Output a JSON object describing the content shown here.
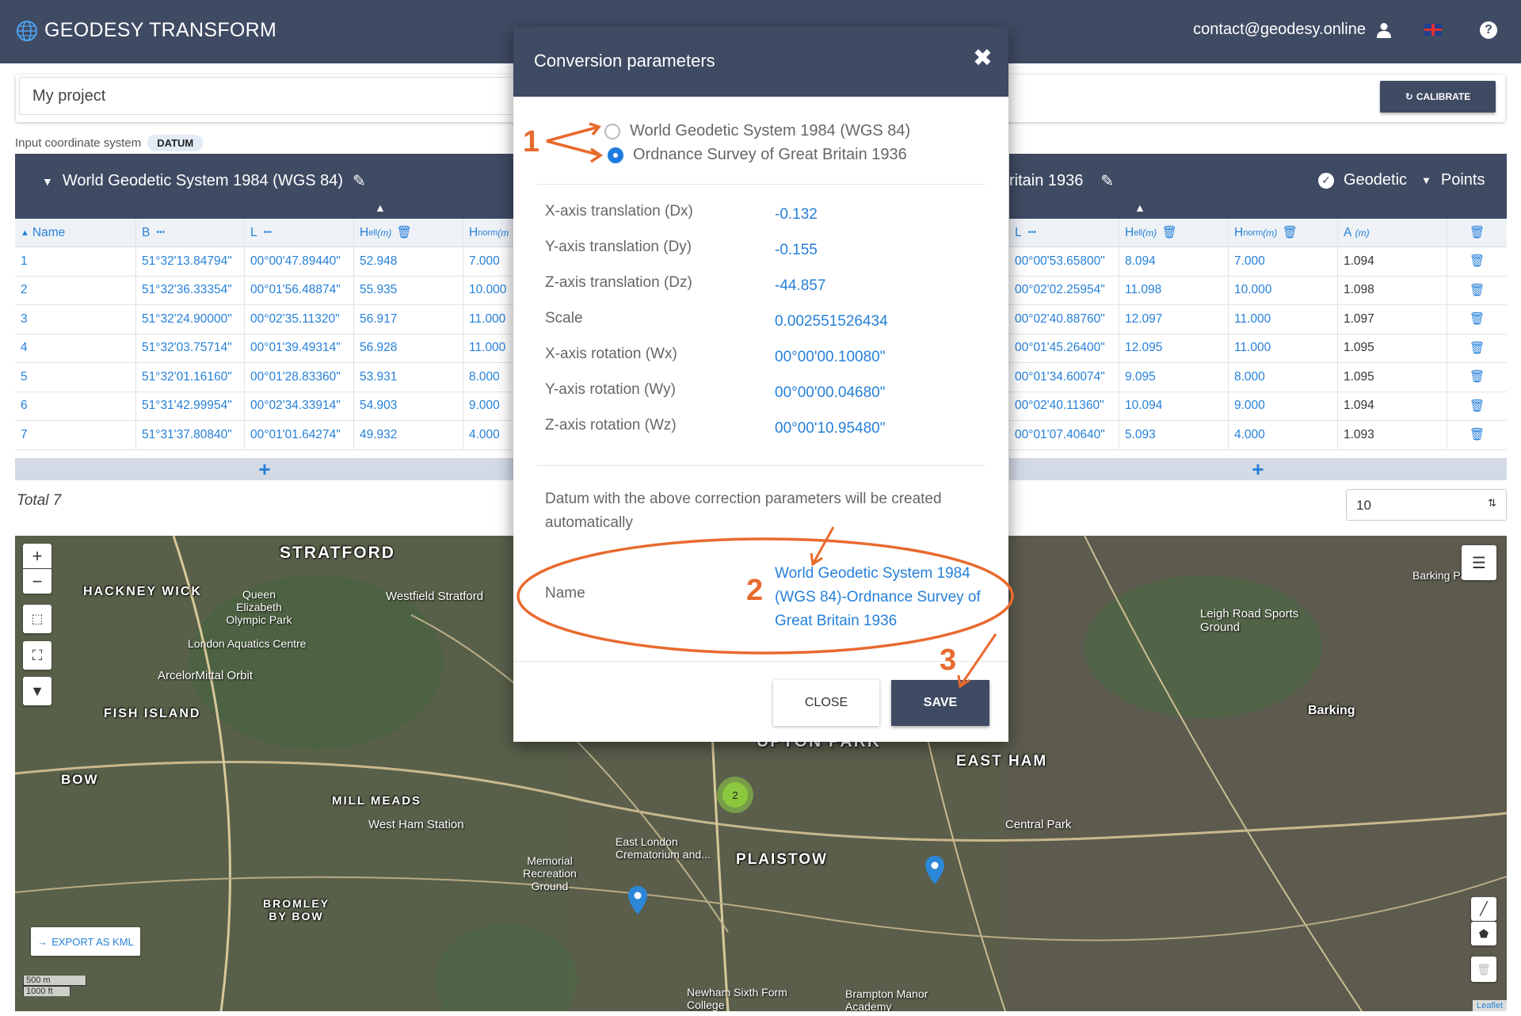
{
  "navbar": {
    "brand": "GEODESY TRANSFORM",
    "email": "contact@geodesy.online"
  },
  "project": {
    "name": "My project",
    "calibrate_label": "CALIBRATE"
  },
  "input_cs": {
    "label": "Input coordinate system",
    "badge": "DATUM"
  },
  "left_table": {
    "title": "World Geodetic System 1984 (WGS 84)",
    "headers": {
      "name": "Name",
      "b": "B",
      "l": "L",
      "hell": "H",
      "hell_sub": "ell",
      "hell_unit": "(m)",
      "hnorm": "H",
      "hnorm_sub": "norm",
      "hnorm_unit": "(m"
    },
    "rows": [
      [
        "1",
        "51°32'13.84794\"",
        "00°00'47.89440\"",
        "52.948",
        "7.000"
      ],
      [
        "2",
        "51°32'36.33354\"",
        "00°01'56.48874\"",
        "55.935",
        "10.000"
      ],
      [
        "3",
        "51°32'24.90000\"",
        "00°02'35.11320\"",
        "56.917",
        "11.000"
      ],
      [
        "4",
        "51°32'03.75714\"",
        "00°01'39.49314\"",
        "56.928",
        "11.000"
      ],
      [
        "5",
        "51°32'01.16160\"",
        "00°01'28.83360\"",
        "53.931",
        "8.000"
      ],
      [
        "6",
        "51°31'42.99954\"",
        "00°02'34.33914\"",
        "54.903",
        "9.000"
      ],
      [
        "7",
        "51°31'37.80840\"",
        "00°01'01.64274\"",
        "49.932",
        "4.000"
      ]
    ],
    "total": "Total 7"
  },
  "right_table": {
    "title": "ritain 1936",
    "geodetic_label": "Geodetic",
    "points_label": "Points",
    "headers": {
      "l": "L",
      "hell": "H",
      "hell_sub": "ell",
      "hell_unit": "(m)",
      "hnorm": "H",
      "hnorm_sub": "norm",
      "hnorm_unit": "(m)",
      "a": "A",
      "a_unit": "(m)"
    },
    "rows": [
      [
        "00°00'53.65800\"",
        "8.094",
        "7.000",
        "1.094"
      ],
      [
        "00°02'02.25954\"",
        "11.098",
        "10.000",
        "1.098"
      ],
      [
        "00°02'40.88760\"",
        "12.097",
        "11.000",
        "1.097"
      ],
      [
        "00°01'45.26400\"",
        "12.095",
        "11.000",
        "1.095"
      ],
      [
        "00°01'34.60074\"",
        "9.095",
        "8.000",
        "1.095"
      ],
      [
        "00°02'40.11360\"",
        "10.094",
        "9.000",
        "1.094"
      ],
      [
        "00°01'07.40640\"",
        "5.093",
        "4.000",
        "1.093"
      ]
    ],
    "page_size": "10"
  },
  "map": {
    "labels": [
      "STRATFORD",
      "HACKNEY WICK",
      "FISH ISLAND",
      "BOW",
      "MILL MEADS",
      "UPTON PARK",
      "EAST HAM",
      "PLAISTOW",
      "BROMLEY BY BOW",
      "Barking"
    ],
    "places": [
      "Westfield Stratford",
      "Queen Elizabeth Olympic Park",
      "London Aquatics Centre",
      "ArcelorMittal Orbit",
      "West Ham Station",
      "Memorial Recreation Ground",
      "East London Crematorium and...",
      "Leigh Road Sports Ground",
      "Central Park",
      "Newham Sixth Form College",
      "Brampton Manor Academy",
      "Barking Park"
    ],
    "cluster_count": "2",
    "export_label": "EXPORT AS KML",
    "scale_m": "500 m",
    "scale_ft": "1000 ft",
    "attribution": "Leaflet"
  },
  "modal": {
    "title": "Conversion parameters",
    "radio_options": [
      {
        "label": "World Geodetic System 1984 (WGS 84)",
        "checked": false
      },
      {
        "label": "Ordnance Survey of Great Britain 1936",
        "checked": true
      }
    ],
    "params": [
      {
        "label": "X-axis translation (Dx)",
        "value": "-0.132"
      },
      {
        "label": "Y-axis translation (Dy)",
        "value": "-0.155"
      },
      {
        "label": "Z-axis translation (Dz)",
        "value": "-44.857"
      },
      {
        "label": "Scale",
        "value": "0.002551526434"
      },
      {
        "label": "X-axis rotation (Wx)",
        "value": "00°00'00.10080\""
      },
      {
        "label": "Y-axis rotation (Wy)",
        "value": "00°00'00.04680\""
      },
      {
        "label": "Z-axis rotation (Wz)",
        "value": "00°00'10.95480\""
      }
    ],
    "note": "Datum with the above correction parameters will be created automatically",
    "name_label": "Name",
    "name_value": "World Geodetic System 1984 (WGS 84)-Ordnance Survey of Great Britain 1936",
    "close_label": "CLOSE",
    "save_label": "SAVE"
  },
  "annotations": [
    "1",
    "2",
    "3"
  ],
  "colors": {
    "navy": "#3f4a63",
    "link": "#2680d9",
    "annotation": "#e86a2e"
  }
}
